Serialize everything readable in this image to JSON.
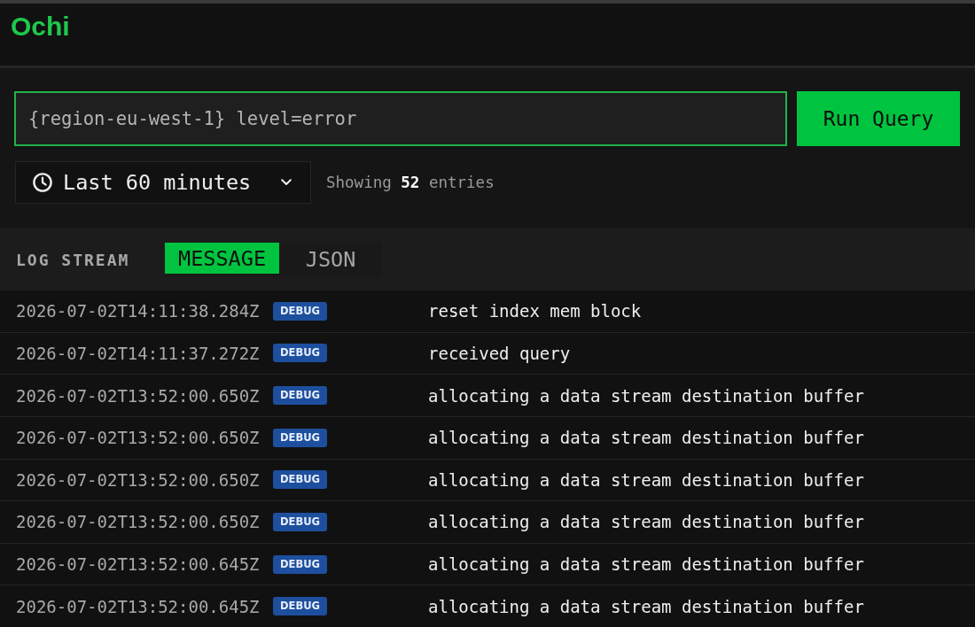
{
  "app": {
    "logo": "Ochi"
  },
  "query": {
    "value": "{region-eu-west-1} level=error",
    "run_button": "Run Query"
  },
  "time_range": {
    "label": "Last 60 minutes"
  },
  "summary": "Showing **52** entries",
  "log_stream": {
    "title": "LOG STREAM",
    "tabs": [
      {
        "label": "MESSAGE",
        "selected": true
      },
      {
        "label": "JSON",
        "selected": false
      }
    ],
    "rows": [
      {
        "timestamp": "2026-07-02T14:11:38.284Z",
        "level": "DEBUG",
        "message": "reset index mem block"
      },
      {
        "timestamp": "2026-07-02T14:11:37.272Z",
        "level": "DEBUG",
        "message": "received query"
      },
      {
        "timestamp": "2026-07-02T13:52:00.650Z",
        "level": "DEBUG",
        "message": "allocating a data stream destination buffer"
      },
      {
        "timestamp": "2026-07-02T13:52:00.650Z",
        "level": "DEBUG",
        "message": "allocating a data stream destination buffer"
      },
      {
        "timestamp": "2026-07-02T13:52:00.650Z",
        "level": "DEBUG",
        "message": "allocating a data stream destination buffer"
      },
      {
        "timestamp": "2026-07-02T13:52:00.650Z",
        "level": "DEBUG",
        "message": "allocating a data stream destination buffer"
      },
      {
        "timestamp": "2026-07-02T13:52:00.645Z",
        "level": "DEBUG",
        "message": "allocating a data stream destination buffer"
      },
      {
        "timestamp": "2026-07-02T13:52:00.645Z",
        "level": "DEBUG",
        "message": "allocating a data stream destination buffer"
      }
    ]
  }
}
